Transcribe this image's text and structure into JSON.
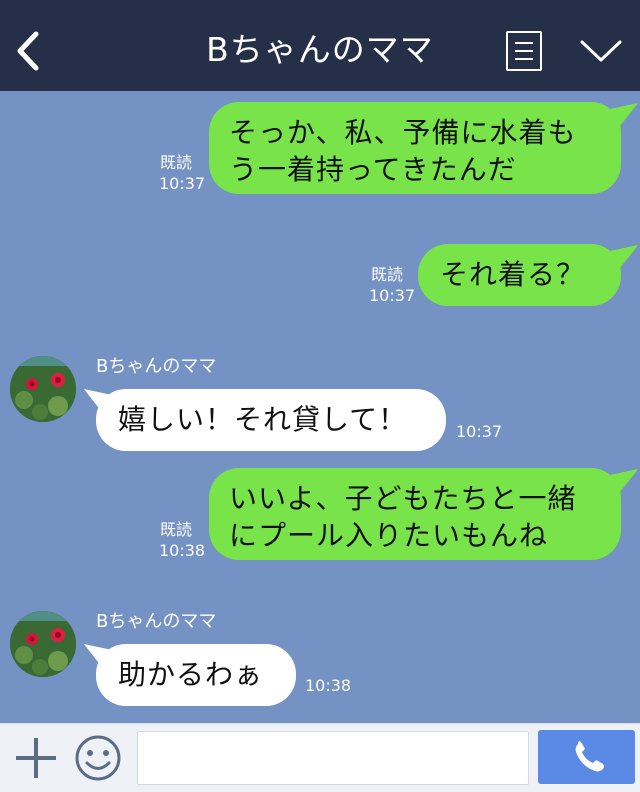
{
  "header": {
    "title": "Bちゃんのママ",
    "back_icon": "chevron-left-icon",
    "menu_icon": "menu-icon",
    "expand_icon": "chevron-down-icon"
  },
  "colors": {
    "header_bg": "#252f47",
    "chat_bg": "#7492c3",
    "outgoing_bubble": "#79e34a",
    "incoming_bubble": "#ffffff",
    "call_button": "#5a8ae6"
  },
  "messages": [
    {
      "direction": "out",
      "lines": [
        "そっか、私、予備に水着も",
        "う一着持ってきたんだ"
      ],
      "read": "既読",
      "time": "10:37"
    },
    {
      "direction": "out",
      "lines": [
        "それ着る？"
      ],
      "read": "既読",
      "time": "10:37"
    },
    {
      "direction": "in",
      "sender": "Bちゃんのママ",
      "lines": [
        "嬉しい！それ貸して！"
      ],
      "time": "10:37"
    },
    {
      "direction": "out",
      "lines": [
        "いいよ、子どもたちと一緒",
        "にプール入りたいもんね"
      ],
      "read": "既読",
      "time": "10:38"
    },
    {
      "direction": "in",
      "sender": "Bちゃんのママ",
      "lines": [
        "助かるわぁ"
      ],
      "time": "10:38"
    }
  ],
  "input_bar": {
    "plus_icon": "plus-icon",
    "emoji_icon": "smiley-icon",
    "input_value": "",
    "call_icon": "phone-icon"
  }
}
